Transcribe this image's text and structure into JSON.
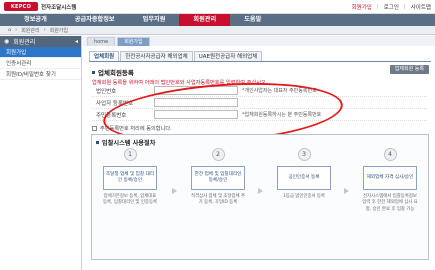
{
  "header": {
    "logo_text": "KEPCO",
    "system_name": "전자조달시스템",
    "user_label": "회원가입",
    "util_links": [
      "로그인",
      "사이트맵"
    ]
  },
  "gnb": [
    "정보공개",
    "공급자종합정보",
    "업무지원",
    "회원관리",
    "도움말"
  ],
  "gnb_active": "회원관리",
  "breadcrumb": [
    "회원관리",
    "회원가입"
  ],
  "sidebar": {
    "title": "회원관리",
    "items": [
      "회원가입",
      "인증서관리",
      "회원ID/비밀번호 찾기"
    ]
  },
  "page_tabs": [
    "home",
    "회원가입"
  ],
  "content_tabs": [
    "업체회원",
    "한전공사자공급자 해외업체",
    "UAE원전공급자 해외업체"
  ],
  "section_title": "업체회원등록",
  "cert_button": "업체회원 등록",
  "notice": "업체회원 등록을 위하여 아래의 법인번호와 사업자등록번호를 입력하여 주십시오.",
  "form": {
    "rows": [
      {
        "label": "법인번호",
        "value": "",
        "hint": "*개인사업자는 대표자 주민등록번호"
      },
      {
        "label": "사업자 등록번호",
        "value": "",
        "hint": ""
      },
      {
        "label": "주민등록번호",
        "value": "",
        "hint": "*업체회원등록하시는 분 주민등록번호"
      }
    ],
    "checkbox_label": "주민등록번호 처리에 동의합니다."
  },
  "process": {
    "title": "입찰시스템 사용절차",
    "steps": [
      {
        "num": "1",
        "box": "조달청 업체 및 입찰 대리인 등록/승인",
        "desc": "업체기본정보 등록, 업체대표 등록, 입찰대리인 및 인증등록"
      },
      {
        "num": "2",
        "box": "한전 업체 및 입찰대리인 등록/승인",
        "desc": "적격심사 업체 및 조달업체 추가 등록, 조달ID 등록"
      },
      {
        "num": "3",
        "box": "공인인증서 등록",
        "desc": "1등급 법인인증서 등록"
      },
      {
        "num": "4",
        "box": "해외업체 자격 심사/승인",
        "desc": "전자시스템에서 입찰등록정보 입력 후 한전 해외업체 심사 요청, 승인 완료 후 입찰 가능"
      }
    ]
  }
}
